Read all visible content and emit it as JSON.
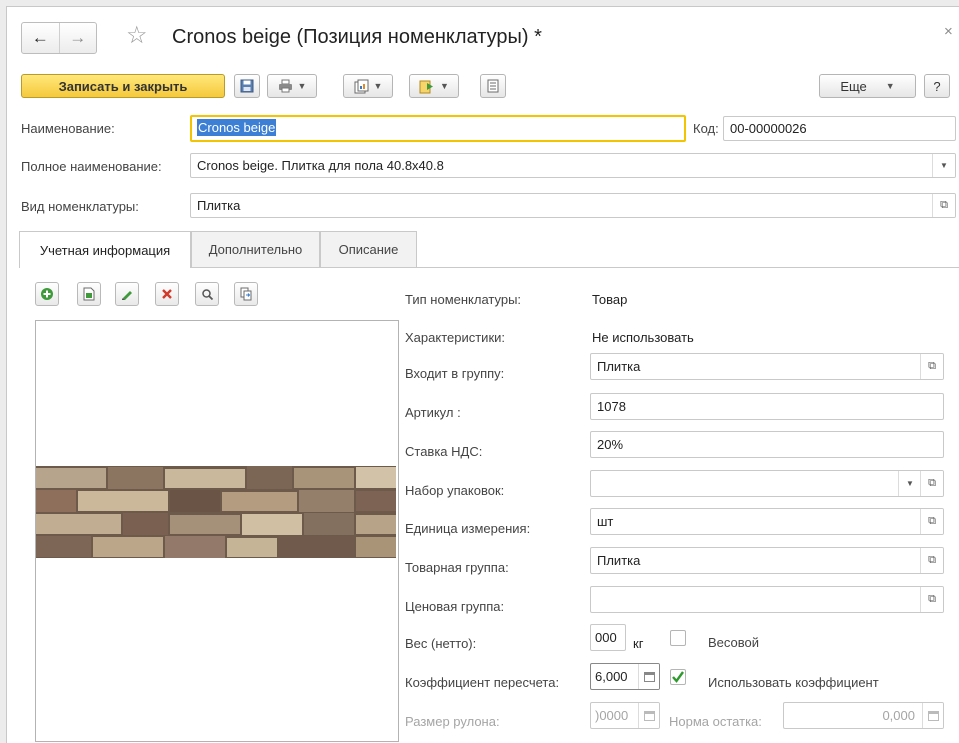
{
  "window": {
    "title": "Cronos beige (Позиция номенклатуры) *",
    "close_glyph": "×",
    "back_glyph": "←",
    "forward_glyph": "→",
    "favorite_glyph": "☆"
  },
  "toolbar": {
    "save_close_label": "Записать и закрыть",
    "more_label": "Еще",
    "help_label": "?",
    "icons": [
      "save-icon",
      "print-icon",
      "reports-icon",
      "create-based-on-icon",
      "list-icon"
    ]
  },
  "header_fields": {
    "name_label": "Наименование:",
    "name_value": "Cronos beige",
    "code_label": "Код:",
    "code_value": "00-00000026",
    "fullname_label": "Полное наименование:",
    "fullname_value": "Cronos beige. Плитка для пола 40.8x40.8",
    "kind_label": "Вид номенклатуры:",
    "kind_value": "Плитка"
  },
  "tabs": [
    {
      "label": "Учетная информация",
      "active": true
    },
    {
      "label": "Дополнительно",
      "active": false
    },
    {
      "label": "Описание",
      "active": false
    }
  ],
  "image_toolbar_icons": [
    "add-icon",
    "select-file-icon",
    "edit-icon",
    "delete-icon",
    "zoom-icon",
    "navigate-icon"
  ],
  "details": {
    "type_label": "Тип номенклатуры:",
    "type_value": "Товар",
    "characteristics_label": "Характеристики:",
    "characteristics_value": "Не использовать",
    "group_label": "Входит в группу:",
    "group_value": "Плитка",
    "article_label": "Артикул :",
    "article_value": "1078",
    "vat_label": "Ставка НДС:",
    "vat_value": "20%",
    "packaging_label": "Набор упаковок:",
    "packaging_value": "",
    "unit_label": "Единица измерения:",
    "unit_value": "шт",
    "product_group_label": "Товарная группа:",
    "product_group_value": "Плитка",
    "price_group_label": "Ценовая группа:",
    "price_group_value": "",
    "weight_label": "Вес (нетто):",
    "weight_value": "000",
    "weight_unit": "кг",
    "weighted_label": "Весовой",
    "weighted_checked": false,
    "coef_label": "Коэффициент пересчета:",
    "coef_value": "6,000",
    "use_coef_label": "Использовать коэффициент",
    "use_coef_checked": true,
    "roll_label": "Размер рулона:",
    "roll_value": ")0000",
    "stock_norm_label": "Норма остатка:",
    "stock_norm_value": "0,000"
  },
  "colors": {
    "primary_button": "#f5c93b",
    "selection": "#3c7fd4",
    "check": "#2e9a2e",
    "delete": "#d23a2a",
    "add": "#3e9a3a"
  }
}
